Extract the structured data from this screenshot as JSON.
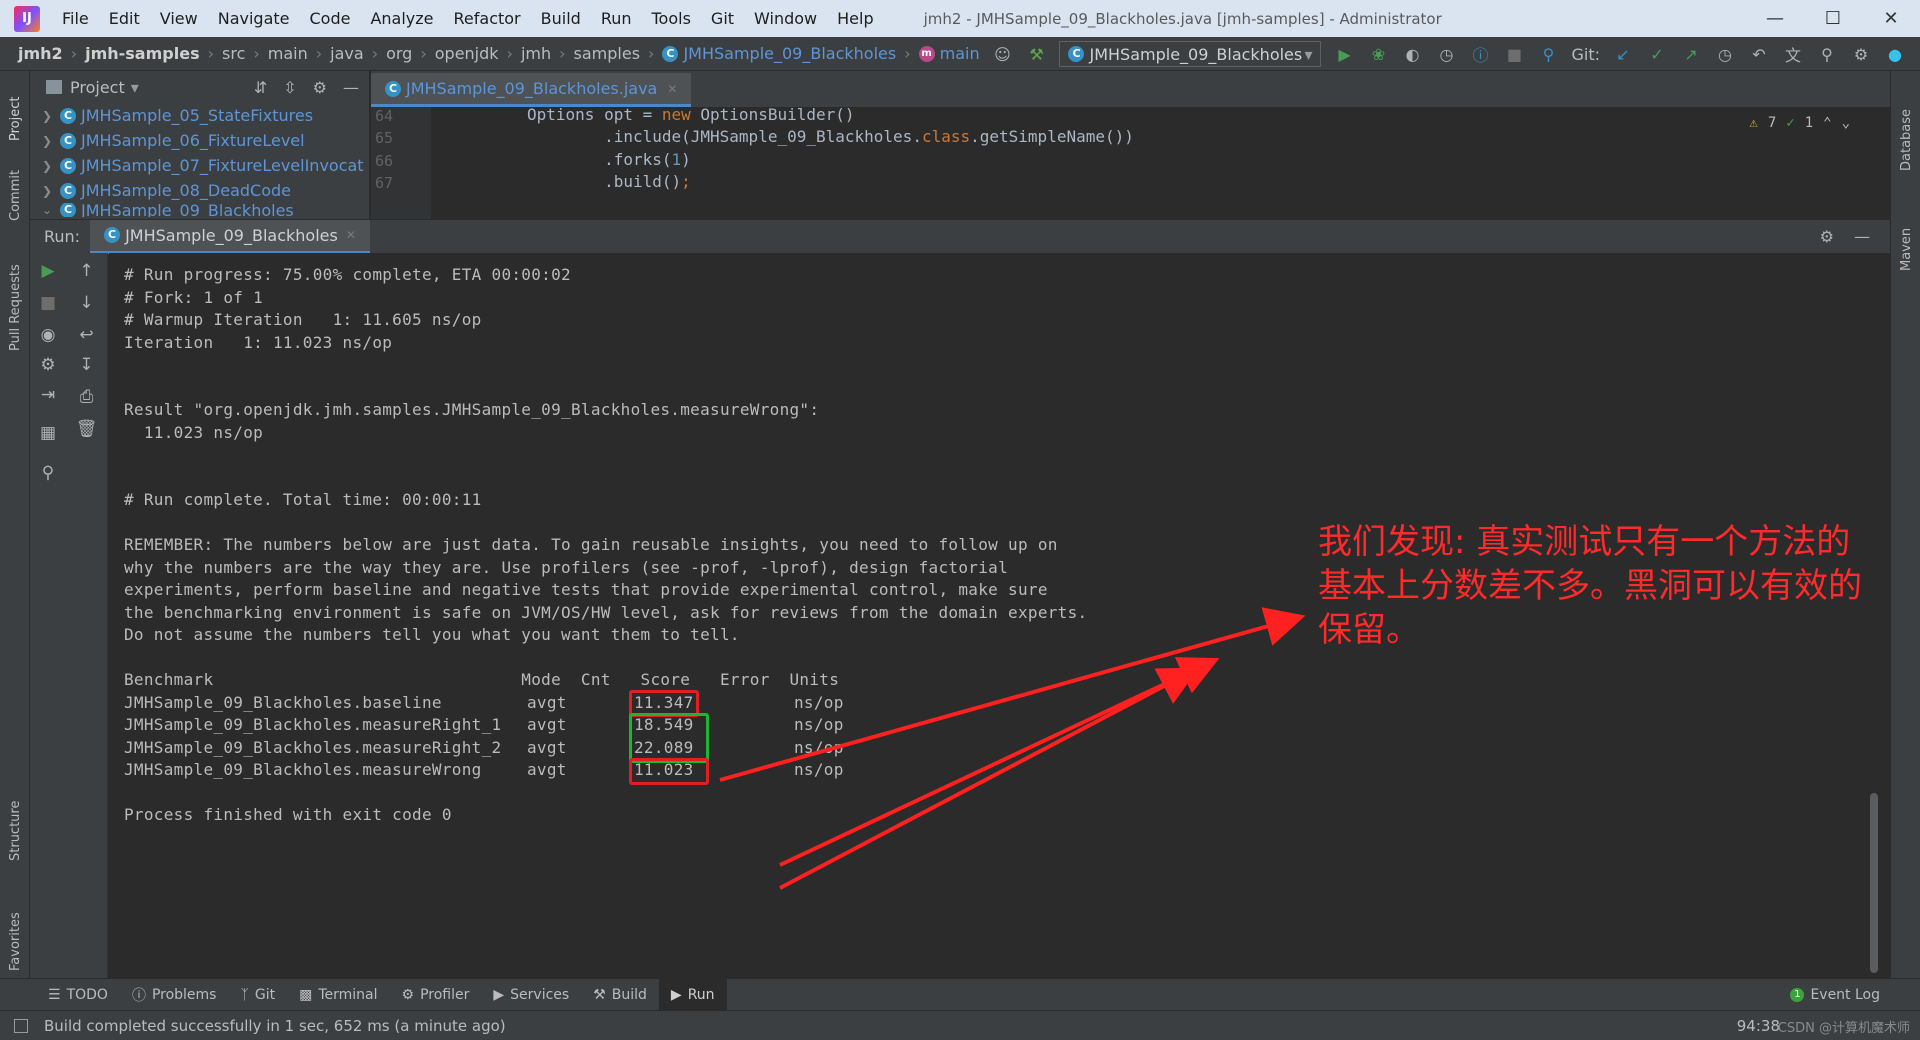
{
  "menu": {
    "items": [
      "File",
      "Edit",
      "View",
      "Navigate",
      "Code",
      "Analyze",
      "Refactor",
      "Build",
      "Run",
      "Tools",
      "Git",
      "Window",
      "Help"
    ],
    "window_title": "jmh2 - JMHSample_09_Blackholes.java [jmh-samples] - Administrator"
  },
  "nav": {
    "crumbs": [
      "jmh2",
      "jmh-samples",
      "src",
      "main",
      "java",
      "org",
      "openjdk",
      "jmh",
      "samples",
      "JMHSample_09_Blackholes",
      "main"
    ],
    "run_config": "JMHSample_09_Blackholes",
    "git_label": "Git:"
  },
  "project": {
    "title": "Project",
    "items": [
      "JMHSample_05_StateFixtures",
      "JMHSample_06_FixtureLevel",
      "JMHSample_07_FixtureLevelInvocat",
      "JMHSample_08_DeadCode",
      "JMHSample_09_Blackholes"
    ]
  },
  "editor": {
    "tab": "JMHSample_09_Blackholes.java",
    "line_numbers": [
      "64",
      "65",
      "66",
      "67"
    ],
    "code": {
      "l64_a": "Options opt = ",
      "l64_kw": "new",
      "l64_b": " OptionsBuilder()",
      "l65_a": "        .include(JMHSample_09_Blackholes.",
      "l65_kw": "class",
      "l65_b": ".getSimpleName())",
      "l66_a": "        .forks(",
      "l66_num": "1",
      "l66_b": ")",
      "l67_a": "        .build()",
      "l67_kw": ";"
    },
    "warnings": "7",
    "checks": "1"
  },
  "vertical_tabs": {
    "project": "Project",
    "commit": "Commit",
    "pull_requests": "Pull Requests",
    "structure": "Structure",
    "favorites": "Favorites",
    "database": "Database",
    "maven": "Maven"
  },
  "run": {
    "label": "Run:",
    "tab": "JMHSample_09_Blackholes"
  },
  "console": {
    "lines": [
      "# Run progress: 75.00% complete, ETA 00:00:02",
      "# Fork: 1 of 1",
      "# Warmup Iteration   1: 11.605 ns/op",
      "Iteration   1: 11.023 ns/op",
      "Result \"org.openjdk.jmh.samples.JMHSample_09_Blackholes.measureWrong\":",
      "  11.023 ns/op",
      "# Run complete. Total time: 00:00:11",
      "REMEMBER: The numbers below are just data. To gain reusable insights, you need to follow up on",
      "why the numbers are the way they are. Use profilers (see -prof, -lprof), design factorial",
      "experiments, perform baseline and negative tests that provide experimental control, make sure",
      "the benchmarking environment is safe on JVM/OS/HW level, ask for reviews from the domain experts.",
      "Do not assume the numbers tell you what you want them to tell.",
      "Process finished with exit code 0"
    ],
    "table_header": "Benchmark                               Mode  Cnt   Score   Error  Units",
    "rows": [
      {
        "name": "JMHSample_09_Blackholes.baseline",
        "mode": "avgt",
        "score": "11.347",
        "units": "ns/op"
      },
      {
        "name": "JMHSample_09_Blackholes.measureRight_1",
        "mode": "avgt",
        "score": "18.549",
        "units": "ns/op"
      },
      {
        "name": "JMHSample_09_Blackholes.measureRight_2",
        "mode": "avgt",
        "score": "22.089",
        "units": "ns/op"
      },
      {
        "name": "JMHSample_09_Blackholes.measureWrong",
        "mode": "avgt",
        "score": "11.023",
        "units": "ns/op"
      }
    ]
  },
  "annotation": {
    "text": "我们发现: 真实测试只有一个方法的基本上分数差不多。黑洞可以有效的保留。"
  },
  "bottom_tools": [
    "TODO",
    "Problems",
    "Git",
    "Terminal",
    "Profiler",
    "Services",
    "Build",
    "Run"
  ],
  "event_log": "Event Log",
  "status": {
    "message": "Build completed successfully in 1 sec, 652 ms (a minute ago)",
    "position": "94:38",
    "watermark": "CSDN @计算机魔术师"
  },
  "colors": {
    "highlight_red": "#e02020",
    "highlight_green": "#1eb332",
    "annotation": "#ff2a2a"
  }
}
